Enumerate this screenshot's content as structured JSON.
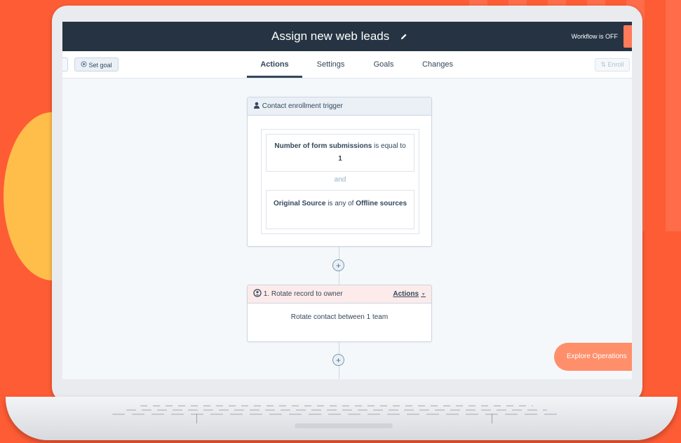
{
  "header": {
    "title": "Assign new web leads",
    "status": "Workflow is OFF"
  },
  "toolbar": {
    "set_goal": "Set goal",
    "enroll": "Enroll"
  },
  "tabs": [
    {
      "label": "Actions",
      "active": true
    },
    {
      "label": "Settings",
      "active": false
    },
    {
      "label": "Goals",
      "active": false
    },
    {
      "label": "Changes",
      "active": false
    }
  ],
  "trigger": {
    "title": "Contact enrollment trigger",
    "filter1": {
      "property": "Number of form submissions",
      "operator": "is equal to",
      "value": "1"
    },
    "joiner": "and",
    "filter2": {
      "property": "Original Source",
      "operator": "is any of",
      "value": "Offline sources"
    }
  },
  "action": {
    "title": "1. Rotate record to owner",
    "menu": "Actions",
    "body": "Rotate contact between 1 team"
  },
  "explore_button": "Explore Operations",
  "colors": {
    "background": "#fe5c35",
    "header": "#253342",
    "accent": "#ff7a59"
  },
  "icons": {
    "edit": "pencil-icon",
    "goal": "target-icon",
    "trigger": "contact-icon",
    "action": "rotate-owner-icon",
    "add": "plus-icon"
  }
}
